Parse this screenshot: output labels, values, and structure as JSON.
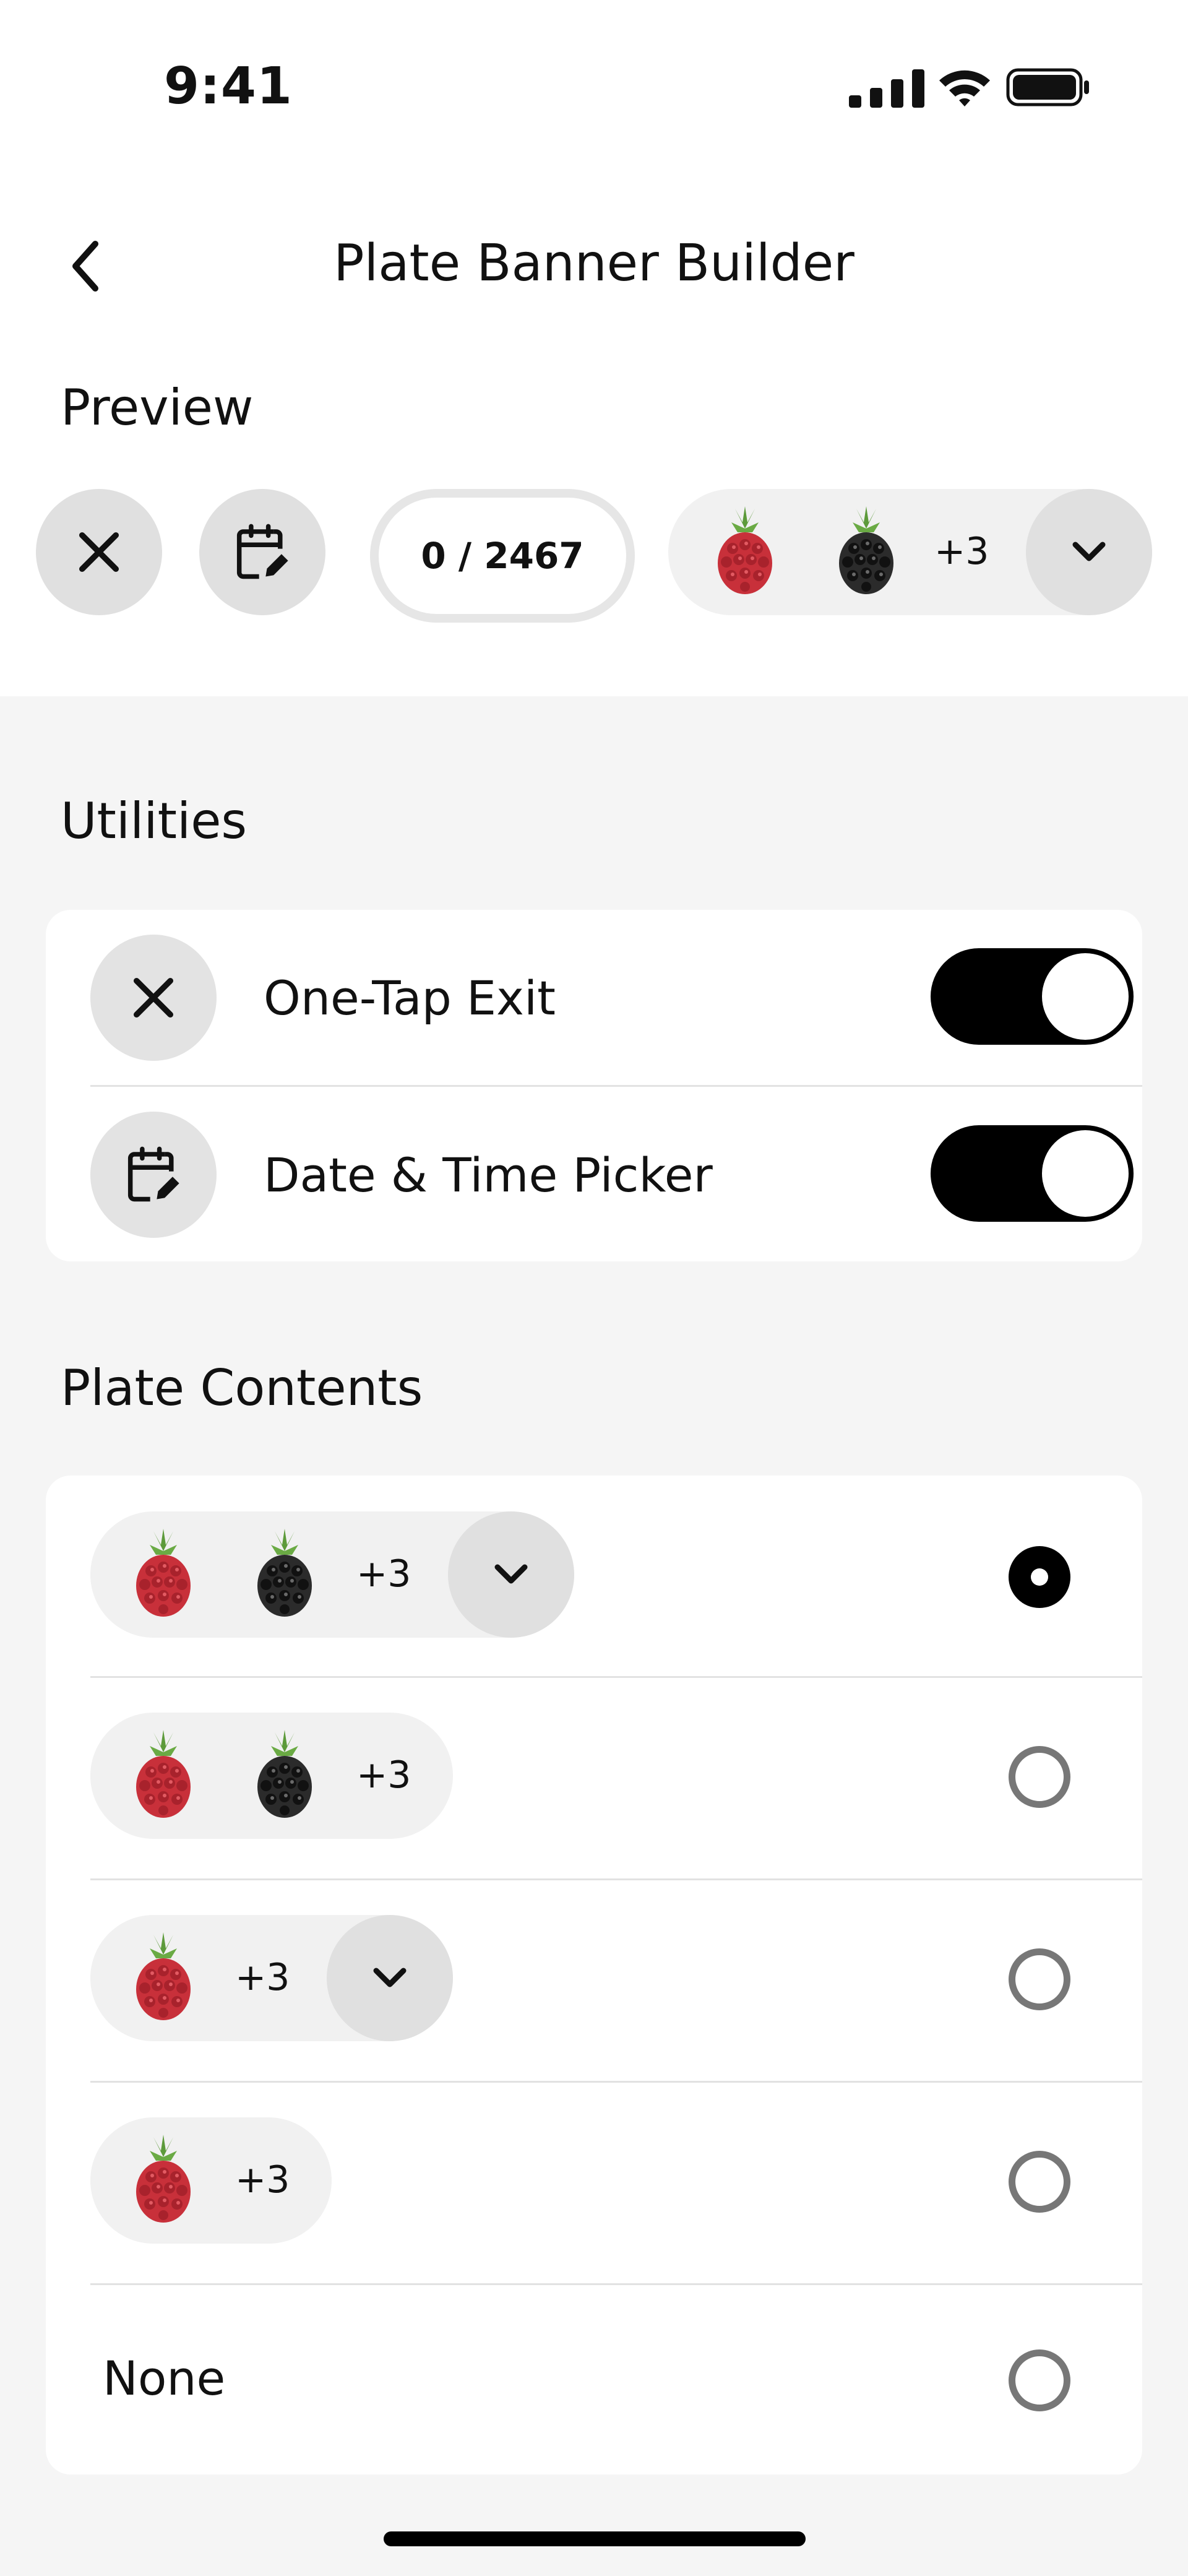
{
  "status_bar": {
    "time": "9:41",
    "icons": [
      "signal-icon",
      "wifi-icon",
      "battery-icon"
    ]
  },
  "nav": {
    "title": "Plate Banner Builder",
    "back_icon": "chevron-left-icon"
  },
  "preview": {
    "title": "Preview",
    "counter": "0 / 2467",
    "chip": {
      "fruits": [
        "raspberry",
        "blackberry"
      ],
      "extra": "+3",
      "expand_icon": "chevron-down-icon"
    }
  },
  "utilities": {
    "title": "Utilities",
    "items": [
      {
        "label": "One-Tap Exit",
        "icon": "close-icon",
        "enabled": true
      },
      {
        "label": "Date & Time Picker",
        "icon": "calendar-edit-icon",
        "enabled": true
      }
    ]
  },
  "plate_contents": {
    "title": "Plate Contents",
    "options": [
      {
        "fruits": [
          "raspberry",
          "blackberry"
        ],
        "extra": "+3",
        "expandable": true,
        "selected": true
      },
      {
        "fruits": [
          "raspberry",
          "blackberry"
        ],
        "extra": "+3",
        "expandable": false,
        "selected": false
      },
      {
        "fruits": [
          "raspberry"
        ],
        "extra": "+3",
        "expandable": true,
        "selected": false
      },
      {
        "fruits": [
          "raspberry"
        ],
        "extra": "+3",
        "expandable": false,
        "selected": false
      },
      {
        "label": "None",
        "selected": false
      }
    ]
  },
  "colors": {
    "background": "#f5f5f5",
    "surface": "#ffffff",
    "chip": "#f1f1f1",
    "button": "#e0e0e0",
    "toggle_on": "#000000",
    "raspberry": "#c8303a",
    "blackberry": "#2b2b2b",
    "leaf": "#5c9a3a"
  }
}
